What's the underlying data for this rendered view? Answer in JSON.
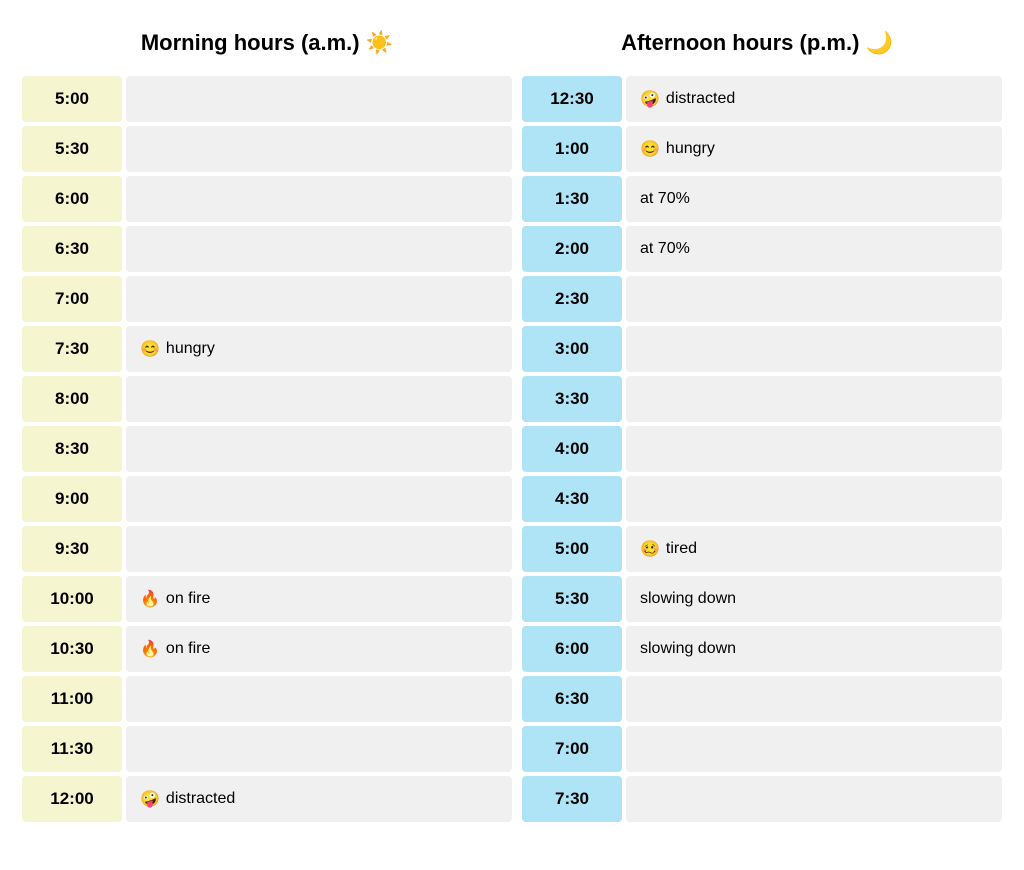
{
  "headers": {
    "morning": "Morning hours (a.m.) ☀️",
    "afternoon": "Afternoon hours (p.m.) 🌙"
  },
  "morning_rows": [
    {
      "time": "5:00",
      "note": "",
      "emoji": ""
    },
    {
      "time": "5:30",
      "note": "",
      "emoji": ""
    },
    {
      "time": "6:00",
      "note": "",
      "emoji": ""
    },
    {
      "time": "6:30",
      "note": "",
      "emoji": ""
    },
    {
      "time": "7:00",
      "note": "",
      "emoji": ""
    },
    {
      "time": "7:30",
      "note": "hungry",
      "emoji": "😊"
    },
    {
      "time": "8:00",
      "note": "",
      "emoji": ""
    },
    {
      "time": "8:30",
      "note": "",
      "emoji": ""
    },
    {
      "time": "9:00",
      "note": "",
      "emoji": ""
    },
    {
      "time": "9:30",
      "note": "",
      "emoji": ""
    },
    {
      "time": "10:00",
      "note": "on fire",
      "emoji": "🔥"
    },
    {
      "time": "10:30",
      "note": "on fire",
      "emoji": "🔥"
    },
    {
      "time": "11:00",
      "note": "",
      "emoji": ""
    },
    {
      "time": "11:30",
      "note": "",
      "emoji": ""
    },
    {
      "time": "12:00",
      "note": "distracted",
      "emoji": "🤪"
    }
  ],
  "afternoon_rows": [
    {
      "time": "12:30",
      "note": "distracted",
      "emoji": "🤪"
    },
    {
      "time": "1:00",
      "note": "hungry",
      "emoji": "😊"
    },
    {
      "time": "1:30",
      "note": "at 70%",
      "emoji": ""
    },
    {
      "time": "2:00",
      "note": "at 70%",
      "emoji": ""
    },
    {
      "time": "2:30",
      "note": "",
      "emoji": ""
    },
    {
      "time": "3:00",
      "note": "",
      "emoji": ""
    },
    {
      "time": "3:30",
      "note": "",
      "emoji": ""
    },
    {
      "time": "4:00",
      "note": "",
      "emoji": ""
    },
    {
      "time": "4:30",
      "note": "",
      "emoji": ""
    },
    {
      "time": "5:00",
      "note": "tired",
      "emoji": "🥴"
    },
    {
      "time": "5:30",
      "note": "slowing down",
      "emoji": ""
    },
    {
      "time": "6:00",
      "note": "slowing down",
      "emoji": ""
    },
    {
      "time": "6:30",
      "note": "",
      "emoji": ""
    },
    {
      "time": "7:00",
      "note": "",
      "emoji": ""
    },
    {
      "time": "7:30",
      "note": "",
      "emoji": ""
    }
  ]
}
